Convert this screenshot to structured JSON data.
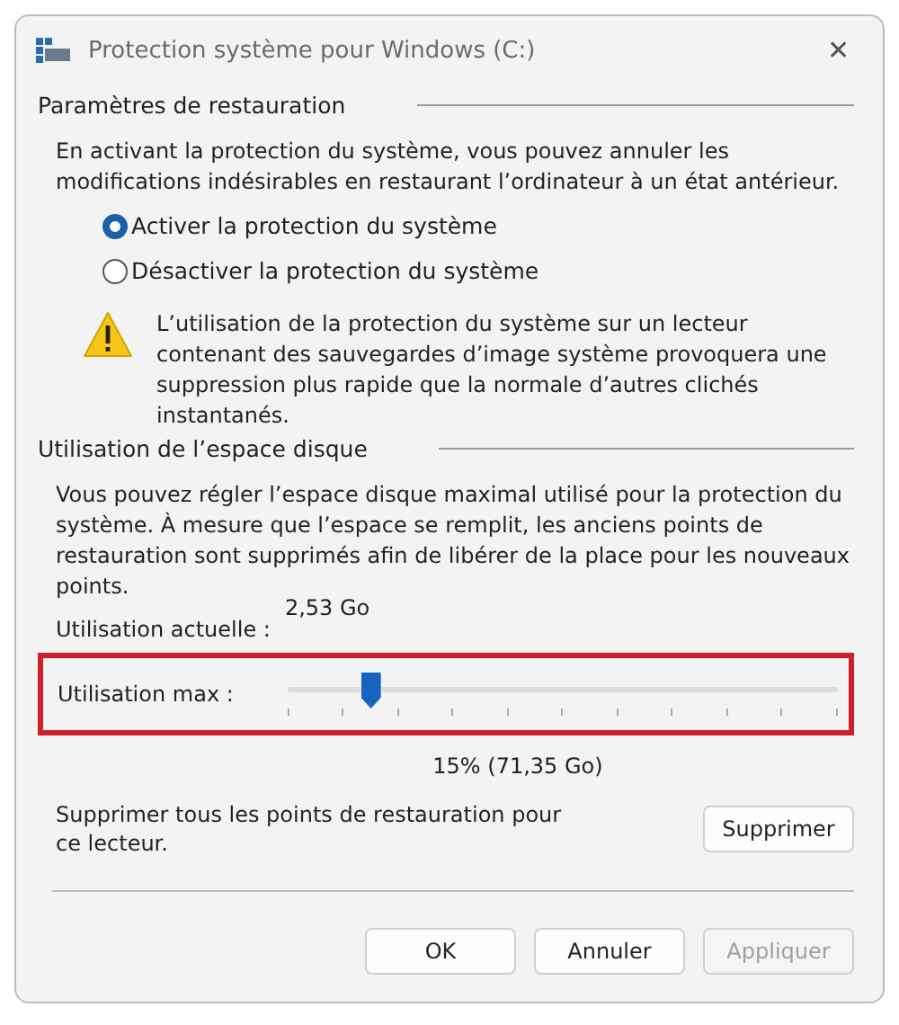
{
  "window": {
    "title": "Protection système pour Windows (C:)",
    "close": "✕"
  },
  "restore_settings": {
    "heading": "Paramètres de restauration",
    "description": "En activant la protection du système, vous pouvez annuler les modifications indésirables en restaurant l’ordinateur à un état antérieur.",
    "options": [
      {
        "label": "Activer la protection du système",
        "selected": true
      },
      {
        "label": "Désactiver la protection du système",
        "selected": false
      }
    ],
    "warning": "L’utilisation de la protection du système sur un lecteur contenant des sauvegardes d’image système provoquera une suppression plus rapide que la normale d’autres clichés instantanés."
  },
  "disk_usage": {
    "heading": "Utilisation de l’espace disque",
    "description": "Vous pouvez régler l’espace disque maximal utilisé pour la protection du système. À mesure que l’espace se remplit, les anciens points de restauration sont supprimés afin de libérer de la place pour les nouveaux points.",
    "current_label": "Utilisation actuelle :",
    "current_value": "2,53 Go",
    "max_label": "Utilisation max :",
    "highlighted": true,
    "level": 0.15,
    "reading": "15% (71,35 Go)",
    "delete_text": "Supprimer tous les points de restauration pour ce lecteur.",
    "delete_button": "Supprimer"
  },
  "buttons": [
    {
      "label": "OK",
      "disabled": false
    },
    {
      "label": "Annuler",
      "disabled": false
    },
    {
      "label": "Appliquer",
      "disabled": true
    }
  ]
}
